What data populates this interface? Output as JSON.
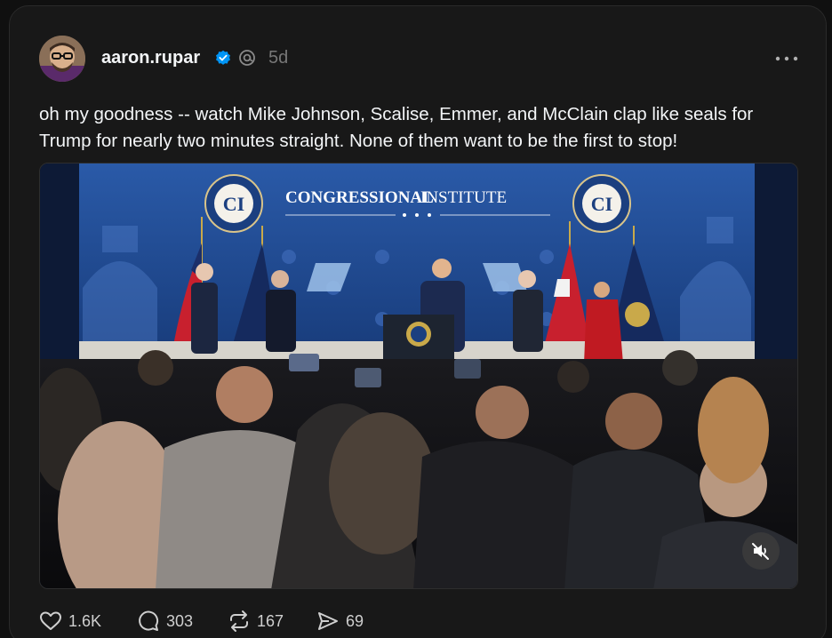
{
  "post": {
    "username": "aaron.rupar",
    "time_ago": "5d",
    "text": "oh my goodness -- watch Mike Johnson, Scalise, Emmer, and McClain clap like seals for Trump for nearly two minutes straight. None of them want to be the first to stop!",
    "video": {
      "banner_bold": "CONGRESSIONAL",
      "banner_light": "INSTITUTE",
      "logo_text": "CI",
      "seal_ring_text": "CONGRESSIONAL INSTITUTE"
    }
  },
  "actions": {
    "likes": "1.6K",
    "replies": "303",
    "reposts": "167",
    "shares": "69"
  },
  "colors": {
    "background": "#101010",
    "card": "#181818",
    "verified": "#0095f6",
    "stage_blue": "#1f4f9c"
  },
  "icons": [
    "verified-icon",
    "threads-icon",
    "more-icon",
    "heart-icon",
    "reply-icon",
    "repost-icon",
    "share-icon",
    "mute-icon"
  ]
}
